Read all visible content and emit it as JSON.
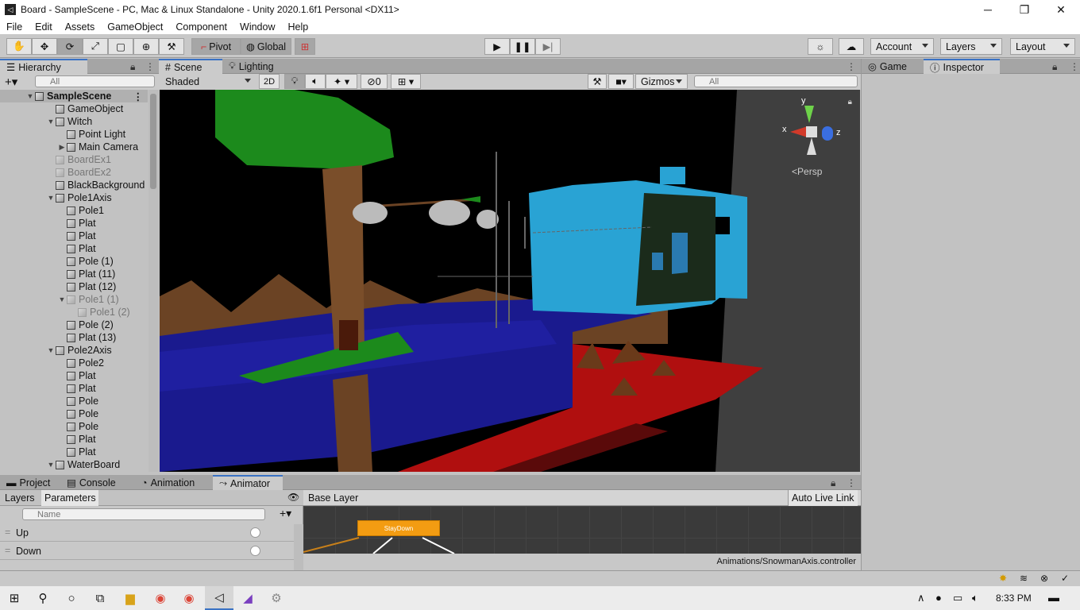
{
  "window": {
    "title": "Board - SampleScene - PC, Mac & Linux Standalone - Unity 2020.1.6f1 Personal <DX11>",
    "min": "─",
    "max": "❐",
    "close": "✕"
  },
  "menu": [
    "File",
    "Edit",
    "Assets",
    "GameObject",
    "Component",
    "Window",
    "Help"
  ],
  "toolbar": {
    "pivot": "Pivot",
    "global": "Global",
    "account": "Account",
    "layers": "Layers",
    "layout": "Layout"
  },
  "hierarchy": {
    "tab": "Hierarchy",
    "search_placeholder": "All",
    "items": [
      {
        "label": "SampleScene",
        "indent": 0,
        "fold": "▼",
        "bold": true,
        "dim": false
      },
      {
        "label": "GameObject",
        "indent": 1,
        "fold": "",
        "dim": false
      },
      {
        "label": "Witch",
        "indent": 1,
        "fold": "▼",
        "dim": false
      },
      {
        "label": "Point Light",
        "indent": 2,
        "fold": "",
        "dim": false
      },
      {
        "label": "Main Camera",
        "indent": 2,
        "fold": "▶",
        "dim": false
      },
      {
        "label": "BoardEx1",
        "indent": 1,
        "fold": "",
        "dim": true
      },
      {
        "label": "BoardEx2",
        "indent": 1,
        "fold": "",
        "dim": true
      },
      {
        "label": "BlackBackground",
        "indent": 1,
        "fold": "",
        "dim": false
      },
      {
        "label": "Pole1Axis",
        "indent": 1,
        "fold": "▼",
        "dim": false
      },
      {
        "label": "Pole1",
        "indent": 2,
        "fold": "",
        "dim": false
      },
      {
        "label": "Plat",
        "indent": 2,
        "fold": "",
        "dim": false
      },
      {
        "label": "Plat",
        "indent": 2,
        "fold": "",
        "dim": false
      },
      {
        "label": "Plat",
        "indent": 2,
        "fold": "",
        "dim": false
      },
      {
        "label": "Pole (1)",
        "indent": 2,
        "fold": "",
        "dim": false
      },
      {
        "label": "Plat (11)",
        "indent": 2,
        "fold": "",
        "dim": false
      },
      {
        "label": "Plat (12)",
        "indent": 2,
        "fold": "",
        "dim": false
      },
      {
        "label": "Pole1 (1)",
        "indent": 2,
        "fold": "▼",
        "dim": true
      },
      {
        "label": "Pole1 (2)",
        "indent": 3,
        "fold": "",
        "dim": true
      },
      {
        "label": "Pole (2)",
        "indent": 2,
        "fold": "",
        "dim": false
      },
      {
        "label": "Plat (13)",
        "indent": 2,
        "fold": "",
        "dim": false
      },
      {
        "label": "Pole2Axis",
        "indent": 1,
        "fold": "▼",
        "dim": false
      },
      {
        "label": "Pole2",
        "indent": 2,
        "fold": "",
        "dim": false
      },
      {
        "label": "Plat",
        "indent": 2,
        "fold": "",
        "dim": false
      },
      {
        "label": "Plat",
        "indent": 2,
        "fold": "",
        "dim": false
      },
      {
        "label": "Pole",
        "indent": 2,
        "fold": "",
        "dim": false
      },
      {
        "label": "Pole",
        "indent": 2,
        "fold": "",
        "dim": false
      },
      {
        "label": "Pole",
        "indent": 2,
        "fold": "",
        "dim": false
      },
      {
        "label": "Plat",
        "indent": 2,
        "fold": "",
        "dim": false
      },
      {
        "label": "Plat",
        "indent": 2,
        "fold": "",
        "dim": false
      },
      {
        "label": "WaterBoard",
        "indent": 1,
        "fold": "▼",
        "dim": false
      }
    ]
  },
  "scene": {
    "tab_scene": "Scene",
    "tab_lighting": "Lighting",
    "shading": "Shaded",
    "mode2d": "2D",
    "hidden_count": "0",
    "gizmos": "Gizmos",
    "search_placeholder": "All",
    "persp": "Persp",
    "axis_x": "x",
    "axis_y": "y",
    "axis_z": "z"
  },
  "inspector": {
    "tab_game": "Game",
    "tab_inspector": "Inspector"
  },
  "bottom": {
    "tab_project": "Project",
    "tab_console": "Console",
    "tab_animation": "Animation",
    "tab_animator": "Animator",
    "layers": "Layers",
    "parameters": "Parameters",
    "name_placeholder": "Name",
    "params": [
      {
        "name": "Up"
      },
      {
        "name": "Down"
      }
    ],
    "base_layer": "Base Layer",
    "auto_live_link": "Auto Live Link",
    "state_name": "StayDown",
    "controller_path": "Animations/SnowmanAxis.controller"
  },
  "taskbar": {
    "time": "8:33 PM"
  }
}
